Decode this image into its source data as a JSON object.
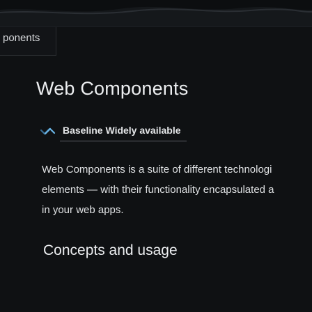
{
  "breadcrumb": {
    "text": "ponents"
  },
  "page": {
    "title": "Web Components",
    "baseline": {
      "status": "Baseline Widely available",
      "icon": "baseline-check-icon"
    },
    "description": {
      "lines": [
        "Web Components is a suite of different technologi",
        "elements — with their functionality encapsulated a",
        "in your web apps."
      ]
    },
    "section_heading": "Concepts and usage"
  },
  "colors": {
    "background": "#0f1113",
    "text": "#eceef0",
    "baseline_check": "#6bb7e8"
  }
}
